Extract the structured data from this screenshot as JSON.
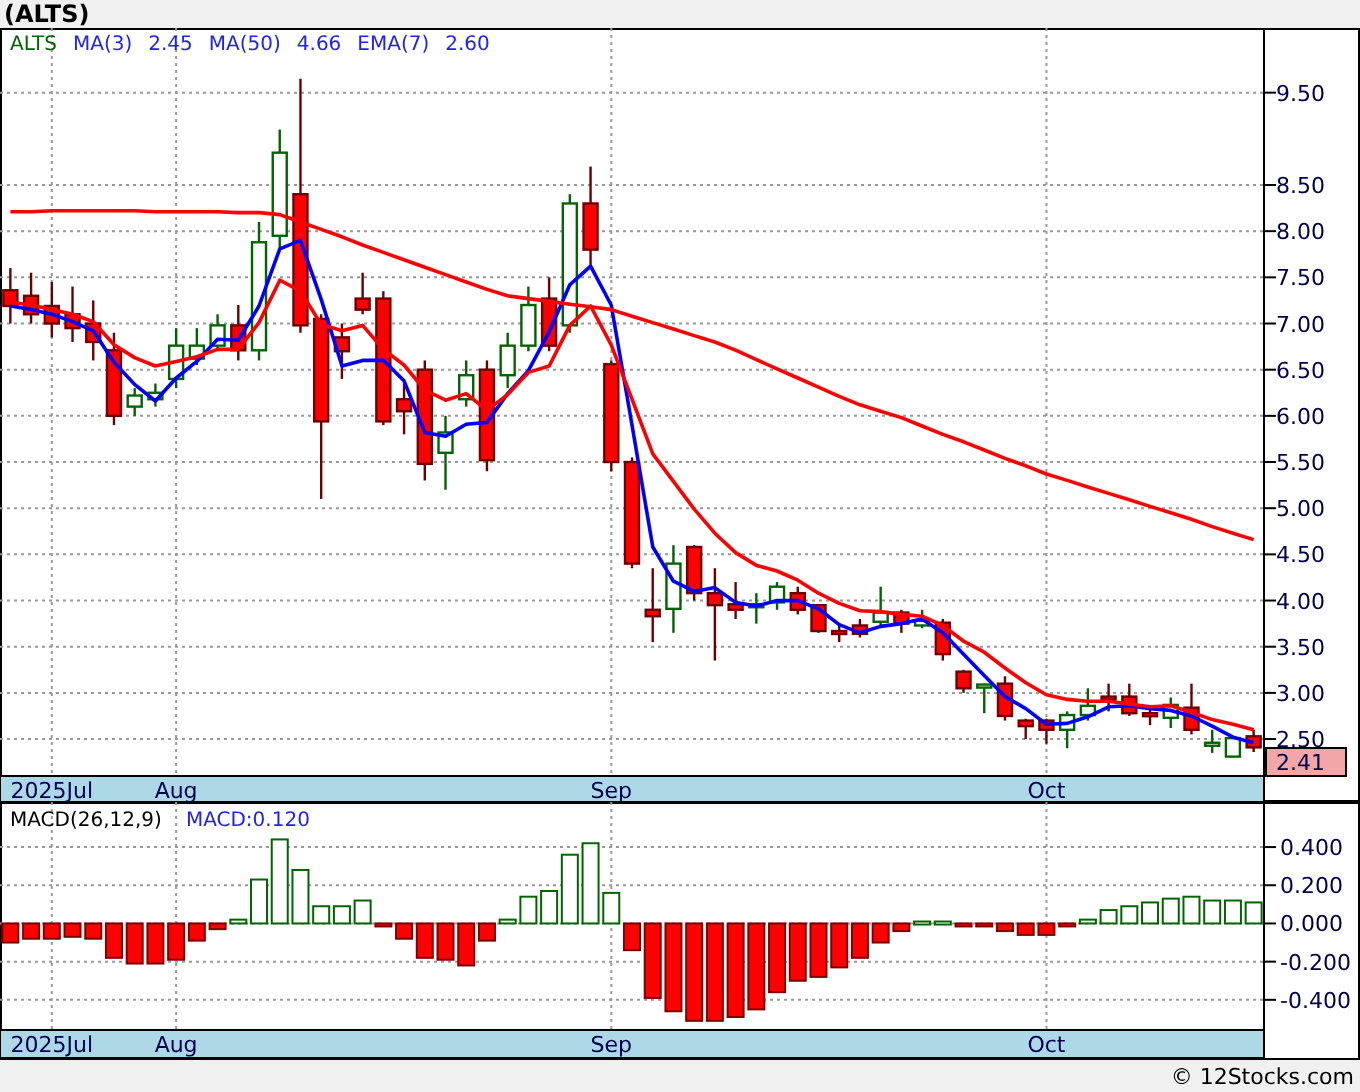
{
  "header": {
    "title": "(ALTS)"
  },
  "price_chart": {
    "legend": {
      "symbol": "ALTS",
      "values": [
        "2.45",
        "4.66",
        "2.60"
      ]
    },
    "last_price": "2.41",
    "chart_data": {
      "type": "candlestick",
      "grid": true,
      "categories": [
        null,
        null,
        "2025Jul",
        null,
        null,
        null,
        null,
        null,
        "Aug",
        null,
        null,
        null,
        null,
        null,
        null,
        null,
        null,
        null,
        null,
        null,
        null,
        null,
        null,
        null,
        null,
        null,
        null,
        null,
        null,
        "Sep",
        null,
        null,
        null,
        null,
        null,
        null,
        null,
        null,
        null,
        null,
        null,
        null,
        null,
        null,
        null,
        null,
        null,
        null,
        null,
        null,
        "Oct",
        null,
        null,
        null,
        null,
        null,
        null,
        null,
        null,
        null,
        null
      ],
      "ylim": [
        2.1,
        10.2
      ],
      "yticks": [
        {
          "value": 2.5,
          "label": "2.50"
        },
        {
          "value": 3,
          "label": "3.00"
        },
        {
          "value": 3.5,
          "label": "3.50"
        },
        {
          "value": 4,
          "label": "4.00"
        },
        {
          "value": 4.5,
          "label": "4.50"
        },
        {
          "value": 5,
          "label": "5.00"
        },
        {
          "value": 5.5,
          "label": "5.50"
        },
        {
          "value": 6,
          "label": "6.00"
        },
        {
          "value": 6.5,
          "label": "6.50"
        },
        {
          "value": 7,
          "label": "7.00"
        },
        {
          "value": 7.5,
          "label": "7.50"
        },
        {
          "value": 8,
          "label": "8.00"
        },
        {
          "value": 8.5,
          "label": "8.50"
        },
        {
          "value": 9.5,
          "label": "9.50"
        }
      ],
      "ohlc": [
        [
          7.36,
          7.6,
          7.0,
          7.19
        ],
        [
          7.3,
          7.55,
          7.0,
          7.1
        ],
        [
          7.19,
          7.45,
          6.85,
          7.0
        ],
        [
          7.1,
          7.4,
          6.8,
          6.95
        ],
        [
          7.0,
          7.25,
          6.6,
          6.8
        ],
        [
          6.71,
          6.9,
          5.9,
          6.0
        ],
        [
          6.1,
          6.3,
          6.0,
          6.22
        ],
        [
          6.18,
          6.35,
          6.1,
          6.25
        ],
        [
          6.4,
          6.95,
          6.3,
          6.76
        ],
        [
          6.62,
          6.95,
          6.55,
          6.76
        ],
        [
          6.76,
          7.1,
          6.7,
          6.98
        ],
        [
          6.98,
          7.2,
          6.6,
          6.71
        ],
        [
          6.71,
          8.1,
          6.6,
          7.88
        ],
        [
          7.95,
          9.1,
          7.8,
          8.85
        ],
        [
          8.4,
          9.65,
          6.9,
          6.98
        ],
        [
          7.05,
          7.1,
          5.1,
          5.94
        ],
        [
          6.85,
          7.0,
          6.4,
          6.7
        ],
        [
          7.27,
          7.55,
          7.1,
          7.15
        ],
        [
          7.27,
          7.35,
          5.9,
          5.94
        ],
        [
          6.18,
          6.35,
          5.8,
          6.05
        ],
        [
          6.5,
          6.6,
          5.3,
          5.48
        ],
        [
          5.6,
          6.0,
          5.2,
          5.82
        ],
        [
          6.18,
          6.6,
          6.1,
          6.44
        ],
        [
          6.5,
          6.6,
          5.4,
          5.52
        ],
        [
          6.44,
          6.9,
          6.3,
          6.76
        ],
        [
          6.76,
          7.4,
          6.7,
          7.2
        ],
        [
          7.27,
          7.5,
          6.7,
          6.76
        ],
        [
          6.98,
          8.4,
          6.9,
          8.3
        ],
        [
          8.3,
          8.7,
          7.6,
          7.8
        ],
        [
          6.56,
          6.6,
          5.4,
          5.5
        ],
        [
          5.5,
          5.55,
          4.35,
          4.4
        ],
        [
          3.9,
          4.35,
          3.55,
          3.83
        ],
        [
          3.91,
          4.6,
          3.65,
          4.4
        ],
        [
          4.58,
          4.6,
          4.0,
          4.08
        ],
        [
          4.08,
          4.35,
          3.35,
          3.95
        ],
        [
          3.96,
          4.2,
          3.8,
          3.9
        ],
        [
          3.93,
          4.08,
          3.75,
          3.96
        ],
        [
          3.98,
          4.2,
          3.9,
          4.15
        ],
        [
          4.08,
          4.15,
          3.85,
          3.9
        ],
        [
          3.95,
          3.96,
          3.65,
          3.67
        ],
        [
          3.67,
          3.75,
          3.55,
          3.64
        ],
        [
          3.73,
          3.8,
          3.6,
          3.64
        ],
        [
          3.77,
          4.15,
          3.7,
          3.87
        ],
        [
          3.87,
          3.9,
          3.65,
          3.75
        ],
        [
          3.73,
          3.9,
          3.7,
          3.78
        ],
        [
          3.76,
          3.8,
          3.35,
          3.42
        ],
        [
          3.23,
          3.25,
          3.0,
          3.05
        ],
        [
          3.06,
          3.1,
          2.78,
          3.09
        ],
        [
          3.1,
          3.18,
          2.7,
          2.75
        ],
        [
          2.7,
          2.72,
          2.5,
          2.64
        ],
        [
          2.7,
          2.72,
          2.45,
          2.6
        ],
        [
          2.6,
          2.8,
          2.4,
          2.76
        ],
        [
          2.76,
          3.05,
          2.7,
          2.86
        ],
        [
          2.96,
          3.1,
          2.8,
          2.94
        ],
        [
          2.96,
          3.1,
          2.75,
          2.78
        ],
        [
          2.78,
          2.85,
          2.65,
          2.77
        ],
        [
          2.73,
          2.95,
          2.62,
          2.87
        ],
        [
          2.84,
          3.1,
          2.55,
          2.6
        ],
        [
          2.43,
          2.6,
          2.35,
          2.46
        ],
        [
          2.31,
          2.52,
          2.3,
          2.51
        ],
        [
          2.53,
          2.6,
          2.36,
          2.41
        ]
      ],
      "series": [
        {
          "name": "MA(3)",
          "type": "line",
          "color": "#0000ff",
          "values": [
            7.19,
            7.15,
            7.1,
            7.02,
            6.92,
            6.58,
            6.34,
            6.16,
            6.41,
            6.59,
            6.83,
            6.82,
            7.19,
            7.81,
            7.9,
            7.26,
            6.54,
            6.6,
            6.6,
            6.38,
            5.82,
            5.78,
            5.91,
            5.93,
            6.24,
            6.49,
            6.91,
            7.42,
            7.62,
            7.2,
            5.9,
            4.58,
            4.21,
            4.1,
            4.14,
            3.98,
            3.94,
            4.0,
            4.0,
            3.91,
            3.74,
            3.65,
            3.72,
            3.75,
            3.8,
            3.65,
            3.42,
            3.19,
            2.96,
            2.83,
            2.66,
            2.67,
            2.74,
            2.85,
            2.86,
            2.83,
            2.81,
            2.75,
            2.64,
            2.52,
            2.46
          ]
        },
        {
          "name": "MA(50)",
          "type": "line",
          "color": "#ff0000",
          "values": [
            8.21,
            8.21,
            8.22,
            8.22,
            8.22,
            8.22,
            8.22,
            8.21,
            8.21,
            8.21,
            8.21,
            8.2,
            8.2,
            8.18,
            8.1,
            8.02,
            7.94,
            7.85,
            7.77,
            7.69,
            7.61,
            7.53,
            7.45,
            7.37,
            7.3,
            7.27,
            7.24,
            7.21,
            7.18,
            7.15,
            7.08,
            7.01,
            6.94,
            6.87,
            6.8,
            6.71,
            6.61,
            6.51,
            6.41,
            6.31,
            6.21,
            6.12,
            6.05,
            5.98,
            5.89,
            5.8,
            5.72,
            5.63,
            5.54,
            5.46,
            5.37,
            5.3,
            5.23,
            5.16,
            5.09,
            5.02,
            4.95,
            4.88,
            4.8,
            4.73,
            4.66
          ]
        },
        {
          "name": "EMA(7)",
          "type": "line",
          "color": "#ff0000",
          "values": [
            7.23,
            7.2,
            7.15,
            7.1,
            7.02,
            6.77,
            6.63,
            6.54,
            6.59,
            6.64,
            6.72,
            6.72,
            7.01,
            7.47,
            7.35,
            6.99,
            6.92,
            6.98,
            6.72,
            6.55,
            6.28,
            6.17,
            6.24,
            6.06,
            6.23,
            6.47,
            6.54,
            6.98,
            7.19,
            6.77,
            6.18,
            5.59,
            5.29,
            4.99,
            4.73,
            4.52,
            4.38,
            4.32,
            4.22,
            4.08,
            3.97,
            3.89,
            3.88,
            3.85,
            3.83,
            3.73,
            3.56,
            3.44,
            3.27,
            3.11,
            2.98,
            2.93,
            2.91,
            2.91,
            2.88,
            2.85,
            2.86,
            2.79,
            2.71,
            2.66,
            2.6
          ]
        }
      ]
    }
  },
  "macd_chart": {
    "legend": {
      "name": "MACD(26,12,9)",
      "value": "MACD:0.120"
    },
    "chart_data": {
      "type": "bar",
      "grid": true,
      "categories": [
        null,
        null,
        "2025Jul",
        null,
        null,
        null,
        null,
        null,
        "Aug",
        null,
        null,
        null,
        null,
        null,
        null,
        null,
        null,
        null,
        null,
        null,
        null,
        null,
        null,
        null,
        null,
        null,
        null,
        null,
        null,
        "Sep",
        null,
        null,
        null,
        null,
        null,
        null,
        null,
        null,
        null,
        null,
        null,
        null,
        null,
        null,
        null,
        null,
        null,
        null,
        null,
        null,
        "Oct",
        null,
        null,
        null,
        null,
        null,
        null,
        null,
        null,
        null,
        null
      ],
      "ylim": [
        -0.558,
        0.636
      ],
      "yticks": [
        {
          "value": 0.4,
          "label": "0.400"
        },
        {
          "value": 0.2,
          "label": "0.200"
        },
        {
          "value": 0,
          "label": "0.000"
        },
        {
          "value": -0.2,
          "label": "-0.200"
        },
        {
          "value": -0.4,
          "label": "-0.400"
        }
      ],
      "values": [
        -0.1,
        -0.08,
        -0.08,
        -0.07,
        -0.08,
        -0.18,
        -0.21,
        -0.21,
        -0.19,
        -0.09,
        -0.03,
        0.02,
        0.23,
        0.44,
        0.28,
        0.09,
        0.09,
        0.12,
        -0.01,
        -0.08,
        -0.18,
        -0.19,
        -0.22,
        -0.09,
        0.02,
        0.14,
        0.17,
        0.36,
        0.42,
        0.16,
        -0.14,
        -0.39,
        -0.46,
        -0.51,
        -0.51,
        -0.49,
        -0.45,
        -0.36,
        -0.3,
        -0.28,
        -0.23,
        -0.18,
        -0.1,
        -0.04,
        0.01,
        0.01,
        -0.01,
        -0.01,
        -0.04,
        -0.06,
        -0.06,
        -0.01,
        0.02,
        0.07,
        0.09,
        0.11,
        0.13,
        0.14,
        0.12,
        0.12,
        0.11
      ]
    }
  },
  "footer": {
    "text": "© 12Stocks.com"
  }
}
